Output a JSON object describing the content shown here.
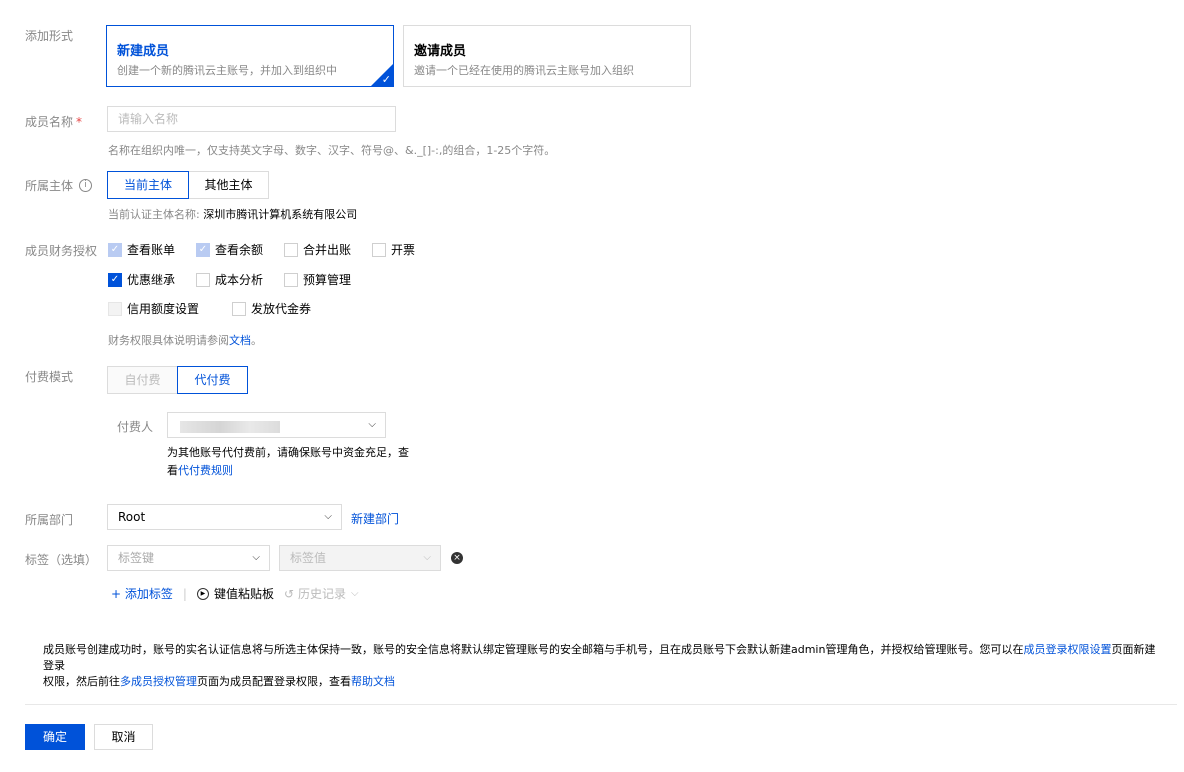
{
  "add_form": {
    "label": "添加形式",
    "options": [
      {
        "title": "新建成员",
        "desc": "创建一个新的腾讯云主账号，并加入到组织中",
        "selected": true
      },
      {
        "title": "邀请成员",
        "desc": "邀请一个已经在使用的腾讯云主账号加入组织",
        "selected": false
      }
    ]
  },
  "member_name": {
    "label": "成员名称",
    "required_mark": "*",
    "placeholder": "请输入名称",
    "hint": "名称在组织内唯一，仅支持英文字母、数字、汉字、符号@、&._[]-:,的组合，1-25个字符。"
  },
  "entity": {
    "label": "所属主体",
    "info_icon": "info-circle-icon",
    "options": [
      "当前主体",
      "其他主体"
    ],
    "selected": "当前主体",
    "current_prefix": "当前认证主体名称:",
    "current_name": "深圳市腾讯计算机系统有限公司"
  },
  "finance": {
    "label": "成员财务授权",
    "items": [
      {
        "label": "查看账单",
        "state": "checked-disabled"
      },
      {
        "label": "查看余额",
        "state": "checked-disabled"
      },
      {
        "label": "合并出账",
        "state": "unchecked"
      },
      {
        "label": "开票",
        "state": "unchecked"
      },
      {
        "label": "优惠继承",
        "state": "checked"
      },
      {
        "label": "成本分析",
        "state": "unchecked"
      },
      {
        "label": "预算管理",
        "state": "unchecked"
      },
      {
        "label": "信用额度设置",
        "state": "disabled"
      },
      {
        "label": "发放代金券",
        "state": "unchecked"
      }
    ],
    "doc_prefix": "财务权限具体说明请参阅",
    "doc_link": "文档",
    "doc_suffix": "。"
  },
  "payment": {
    "label": "付费模式",
    "options": [
      "自付费",
      "代付费"
    ],
    "selected": "代付费",
    "payer_label": "付费人",
    "payer_hint_1": "为其他账号代付费前，请确保账号中资金充足，查",
    "payer_hint_2": "看",
    "payer_rule_link": "代付费规则"
  },
  "department": {
    "label": "所属部门",
    "value": "Root",
    "new_link": "新建部门"
  },
  "tags": {
    "label": "标签（选填）",
    "key_placeholder": "标签键",
    "value_placeholder": "标签值",
    "add_tag": "添加标签",
    "separator": "|",
    "clipboard": "键值粘贴板",
    "history": "历史记录"
  },
  "notice": {
    "p1": "成员账号创建成功时，账号的实名认证信息将与所选主体保持一致，账号的安全信息将默认绑定管理账号的安全邮箱与手机号，且在成员账号下会默认新建admin管理角色，并授权给管理账号。您可以在",
    "link1": "成员登录权限设置",
    "p2": "页面新建登录",
    "p3": "权限，然后前往",
    "link2": "多成员授权管理",
    "p4": "页面为成员配置登录权限，查看",
    "link3": "帮助文档"
  },
  "footer": {
    "confirm": "确定",
    "cancel": "取消"
  },
  "colors": {
    "primary": "#0052d9",
    "required": "#e54545"
  }
}
